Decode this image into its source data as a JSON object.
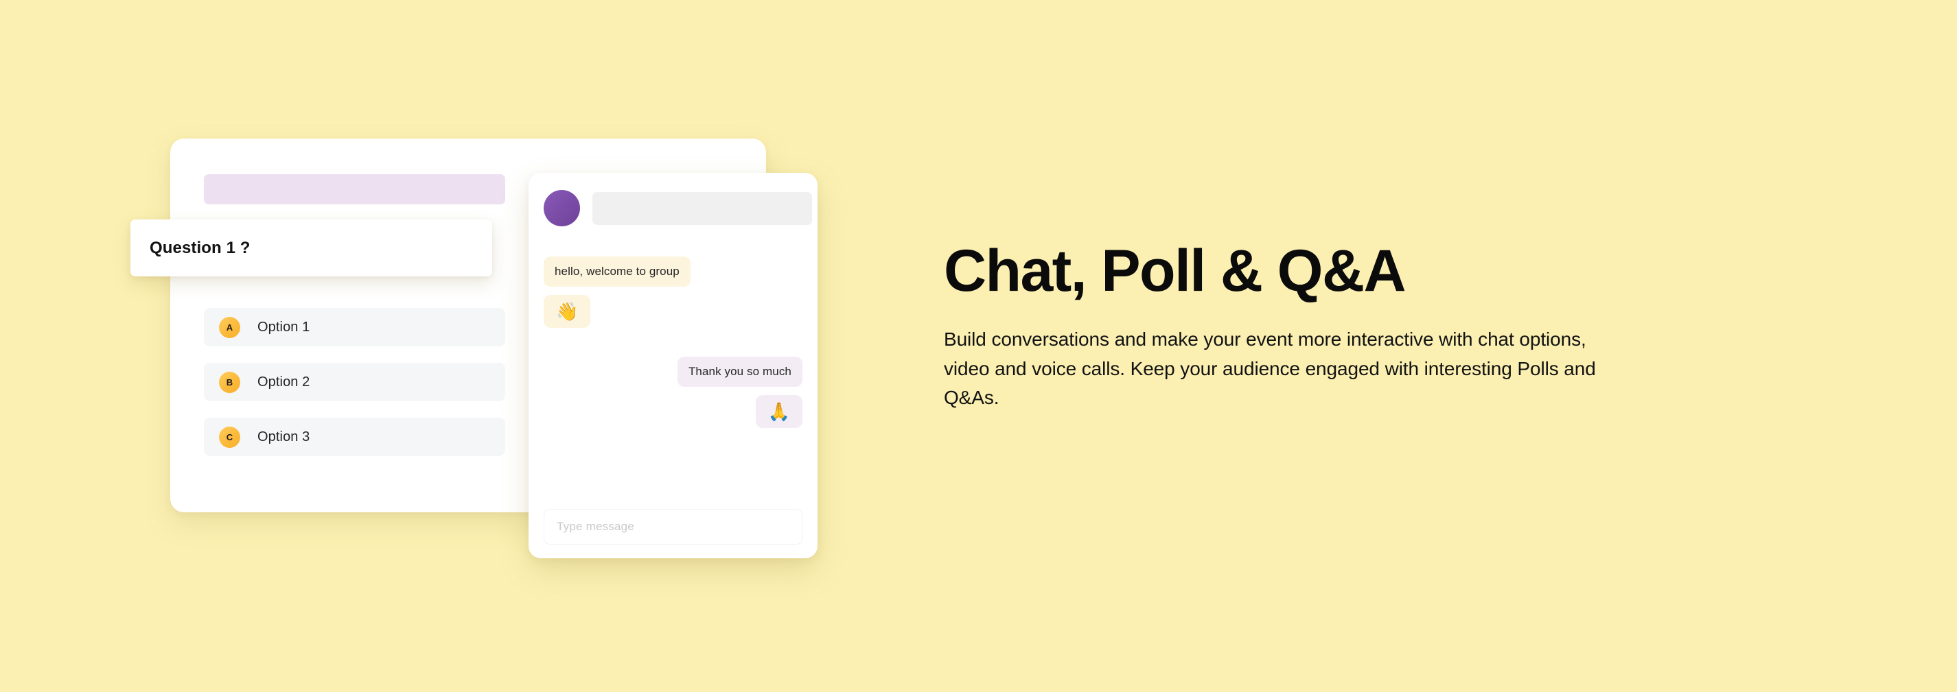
{
  "background_color": "#FBF0B2",
  "poll_card": {
    "topbar_placeholder": "",
    "question": "Question 1 ?",
    "options": [
      {
        "badge": "A",
        "label": "Option 1"
      },
      {
        "badge": "B",
        "label": "Option 2"
      },
      {
        "badge": "C",
        "label": "Option 3"
      }
    ],
    "colors": {
      "card": "#FFFFFF",
      "topbar": "#EDE1F1",
      "option_row": "#F5F6F8",
      "badge": "#FBBA3C"
    }
  },
  "chat_card": {
    "header": {
      "avatar_color": "#7A4CA6",
      "name_placeholder_color": "#F0F0F0"
    },
    "messages": [
      {
        "direction": "in",
        "type": "text",
        "text": "hello, welcome to group"
      },
      {
        "direction": "in",
        "type": "emoji",
        "text": "👋"
      },
      {
        "direction": "out",
        "type": "text",
        "text": "Thank you so much"
      },
      {
        "direction": "out",
        "type": "emoji",
        "text": "🙏"
      }
    ],
    "input": {
      "placeholder": "Type message",
      "value": ""
    },
    "colors": {
      "incoming_bubble": "#FCF4DC",
      "outgoing_bubble": "#F3ECF5"
    }
  },
  "content": {
    "headline": "Chat, Poll & Q&A",
    "body": "Build conversations and make your event more interactive with chat options, video and voice calls. Keep your audience engaged with interesting Polls and Q&As."
  }
}
